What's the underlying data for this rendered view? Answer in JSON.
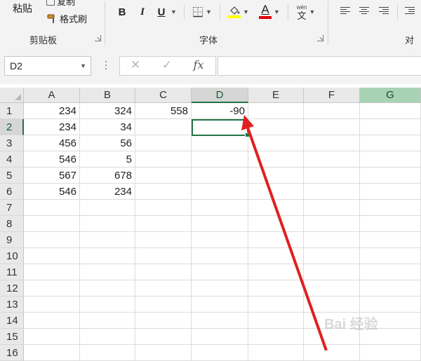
{
  "ribbon": {
    "clipboard": {
      "paste_label": "粘贴",
      "copy_label": "复制",
      "format_painter_label": "格式刷",
      "group_label": "剪贴板"
    },
    "font": {
      "bold": "B",
      "italic": "I",
      "underline": "U",
      "font_color_letter": "A",
      "phonetic_top": "wén",
      "phonetic_char": "文",
      "group_label": "字体"
    },
    "alignment": {
      "group_label": "对齐"
    },
    "colors": {
      "highlight": "#ffff00",
      "font_color": "#e00000"
    }
  },
  "formula_bar": {
    "name_box": "D2",
    "cancel_symbol": "✕",
    "enter_symbol": "✓",
    "fx_label": "fx",
    "formula": ""
  },
  "sheet": {
    "columns": [
      "A",
      "B",
      "C",
      "D",
      "E",
      "F",
      "G"
    ],
    "rows": [
      "1",
      "2",
      "3",
      "4",
      "5",
      "6",
      "7",
      "8",
      "9",
      "10",
      "11",
      "12",
      "13",
      "14",
      "15",
      "16"
    ],
    "selected_cell": "D2",
    "cells": {
      "A1": "234",
      "B1": "324",
      "C1": "558",
      "D1": "-90",
      "A2": "234",
      "B2": "34",
      "A3": "456",
      "B3": "56",
      "A4": "546",
      "B4": "5",
      "A5": "567",
      "B5": "678",
      "A6": "546",
      "B6": "234"
    },
    "accent_color": "#217346"
  },
  "annotation": {
    "arrow_color": "#e02020"
  },
  "watermark": "Bai 经验"
}
